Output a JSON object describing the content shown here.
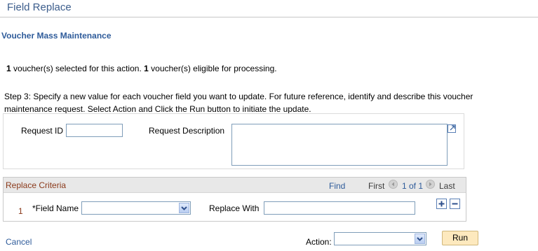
{
  "page_title": "Field Replace",
  "sub_title": "Voucher Mass Maintenance",
  "info": {
    "selected_count": "1",
    "selected_text": "voucher(s) selected for this action.",
    "eligible_count": "1",
    "eligible_text": "voucher(s) eligible for processing."
  },
  "step_text": "Step 3: Specify a new value for each voucher field you want to update. For future reference, identify and describe this voucher maintenance request. Select Action and Click the Run button to initiate the update.",
  "request": {
    "id_label": "Request ID",
    "id_value": "",
    "description_label": "Request Description",
    "description_value": ""
  },
  "grid": {
    "title": "Replace Criteria",
    "find_label": "Find",
    "first_label": "First",
    "range_label": "1 of 1",
    "last_label": "Last",
    "rows": [
      {
        "number": "1",
        "field_name_label": "*Field Name",
        "field_name_value": "",
        "replace_with_label": "Replace With",
        "replace_with_value": ""
      }
    ],
    "add_symbol": "+",
    "delete_symbol": "−"
  },
  "footer": {
    "cancel_label": "Cancel",
    "action_label": "Action:",
    "action_value": "",
    "run_label": "Run"
  },
  "colors": {
    "title": "#3c5d8c",
    "link": "#2e5b9a",
    "grid_title": "#8b3a1b",
    "run_button": "#fde9be"
  }
}
